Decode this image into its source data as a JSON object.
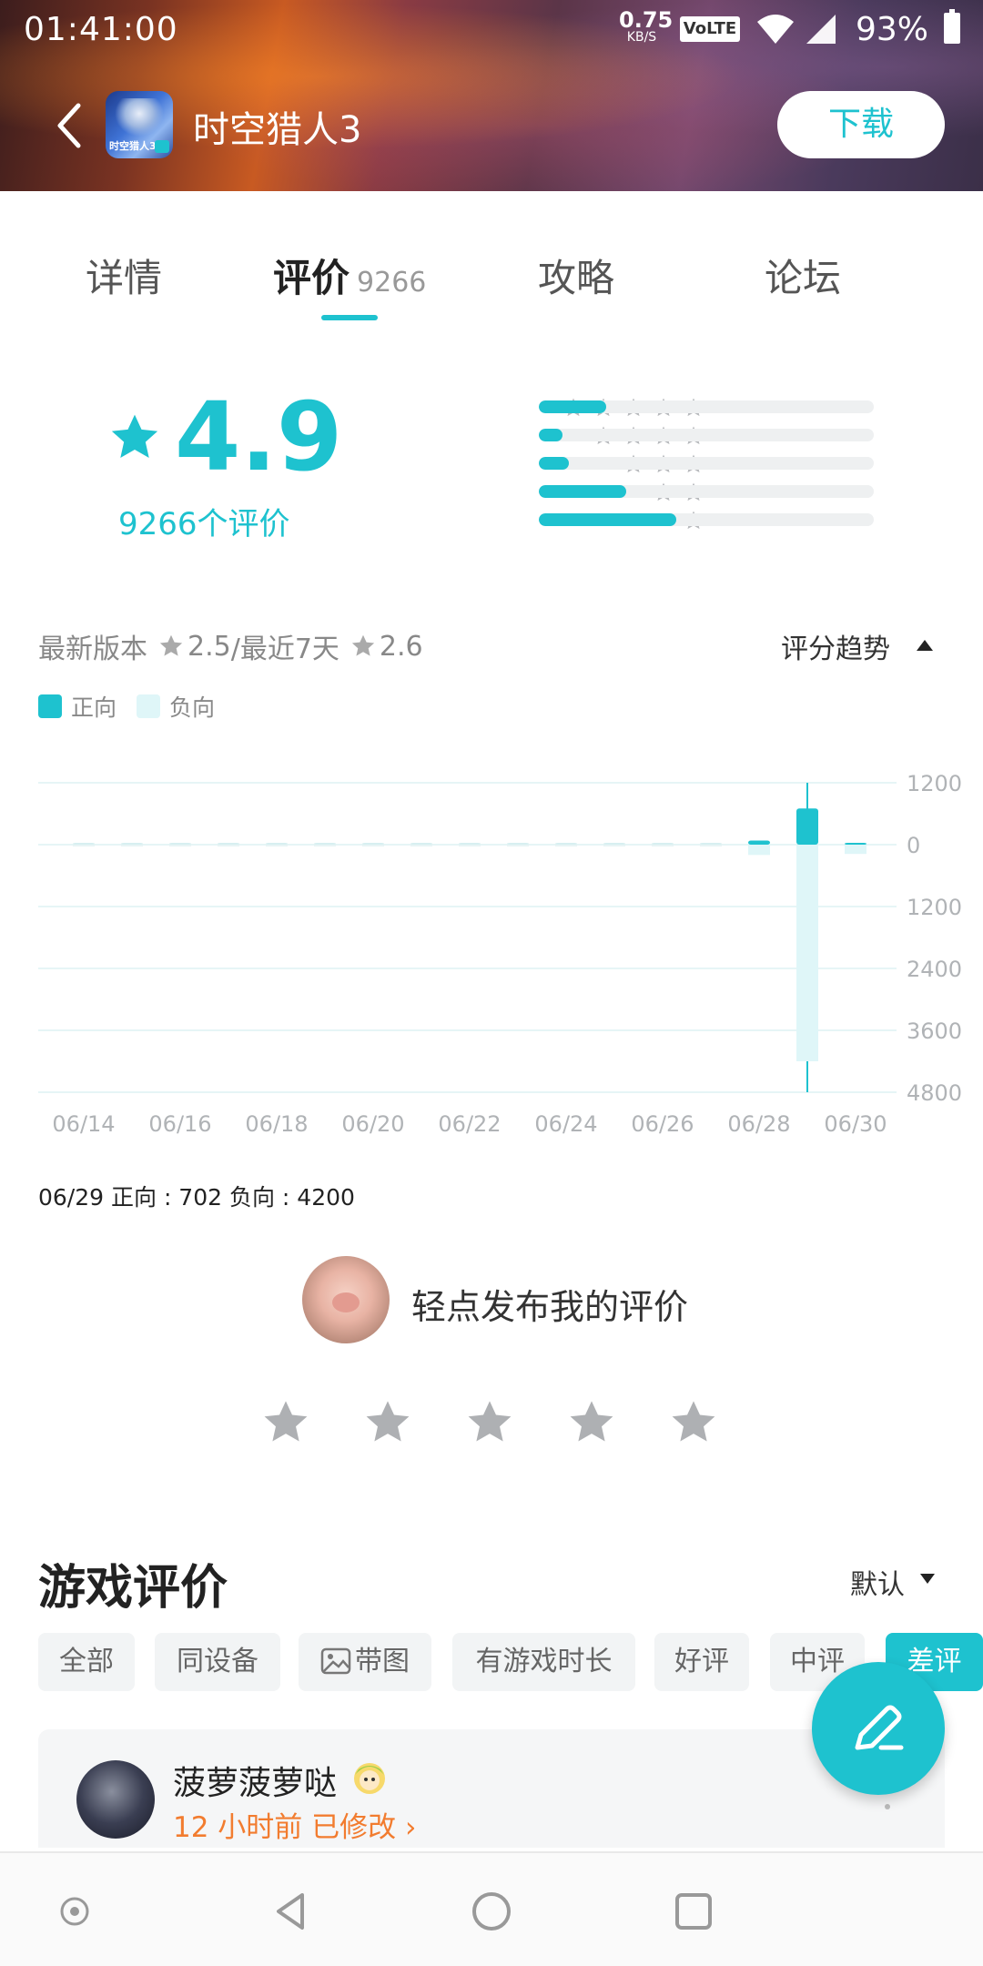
{
  "status_bar": {
    "time": "01:41:00",
    "speed_value": "0.75",
    "speed_unit": "KB/S",
    "volte": "VoLTE",
    "battery": "93%"
  },
  "app_bar": {
    "title": "时空猎人3",
    "icon_text": "时空猎人3",
    "download_label": "下载"
  },
  "tabs": [
    {
      "label": "详情"
    },
    {
      "label": "评价",
      "count": "9266"
    },
    {
      "label": "攻略"
    },
    {
      "label": "论坛"
    }
  ],
  "rating": {
    "score": "4.9",
    "count_label": "9266个评价",
    "distribution": [
      {
        "stars": 5,
        "fraction": 0.2
      },
      {
        "stars": 4,
        "fraction": 0.07
      },
      {
        "stars": 3,
        "fraction": 0.09
      },
      {
        "stars": 2,
        "fraction": 0.26
      },
      {
        "stars": 1,
        "fraction": 0.41
      }
    ]
  },
  "version": {
    "latest_label": "最新版本",
    "latest_score": "2.5",
    "recent_label": "/最近7天",
    "recent_score": "2.6",
    "trend_label": "评分趋势"
  },
  "legend": {
    "positive": "正向",
    "negative": "负向"
  },
  "colors": {
    "accent": "#1ec2cf",
    "negative": "#dff6f8",
    "orange": "#f27c2f"
  },
  "chart_data": {
    "type": "bar",
    "categories": [
      "06/14",
      "06/15",
      "06/16",
      "06/17",
      "06/18",
      "06/19",
      "06/20",
      "06/21",
      "06/22",
      "06/23",
      "06/24",
      "06/25",
      "06/26",
      "06/27",
      "06/28",
      "06/29",
      "06/30"
    ],
    "x_tick_labels": [
      "06/14",
      "06/16",
      "06/18",
      "06/20",
      "06/22",
      "06/24",
      "06/26",
      "06/28",
      "06/30"
    ],
    "y_tick_labels": [
      "1200",
      "0",
      "1200",
      "2400",
      "3600",
      "4800"
    ],
    "series": [
      {
        "name": "正向",
        "values": [
          0,
          0,
          0,
          0,
          0,
          0,
          0,
          0,
          0,
          0,
          0,
          0,
          0,
          0,
          80,
          702,
          20
        ]
      },
      {
        "name": "负向",
        "values": [
          0,
          0,
          0,
          0,
          0,
          0,
          0,
          0,
          0,
          0,
          0,
          0,
          0,
          0,
          200,
          4200,
          180
        ]
      }
    ],
    "ylim": [
      -4800,
      1200
    ],
    "highlighted_category": "06/29"
  },
  "chart_caption": "06/29 正向 : 702  负向 : 4200",
  "compose": {
    "prompt": "轻点发布我的评价"
  },
  "reviews": {
    "title": "游戏评价",
    "sort_label": "默认",
    "filters": [
      {
        "label": "全部"
      },
      {
        "label": "同设备"
      },
      {
        "label": "带图"
      },
      {
        "label": "有游戏时长"
      },
      {
        "label": "好评"
      },
      {
        "label": "中评"
      },
      {
        "label": "差评",
        "active": true
      }
    ],
    "items": [
      {
        "user": "菠萝菠萝哒",
        "time": "12 小时前 已修改 ›"
      }
    ]
  }
}
